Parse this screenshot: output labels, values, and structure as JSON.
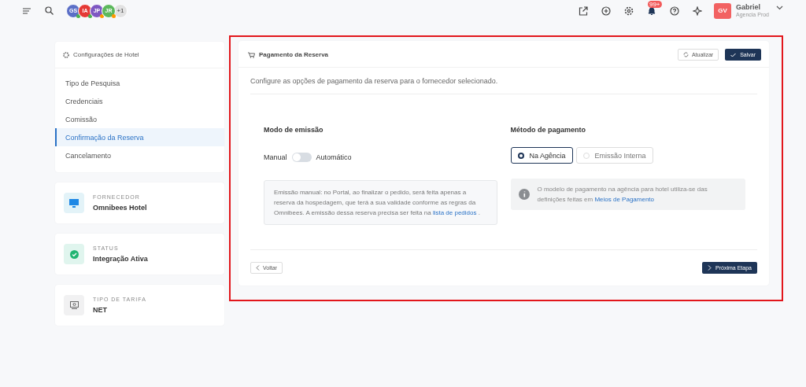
{
  "topbar": {
    "avatars": [
      {
        "initials": "GS",
        "color": "#5b6fc7",
        "status_dot": {
          "color": "#4caf50"
        }
      },
      {
        "initials": "IA",
        "color": "#e53935",
        "status_dot": {
          "color": "#4caf50"
        }
      },
      {
        "initials": "JP",
        "color": "#7e57c2",
        "status_dot": {
          "color": "#ff9800"
        }
      },
      {
        "initials": "JR",
        "color": "#5cb85c",
        "status_dot": {
          "color": "#ff9800"
        }
      }
    ],
    "more_count": "+1",
    "notification_badge": "99+",
    "user": {
      "initials": "GV",
      "name": "Gabriel",
      "agency": "Agencia Prod"
    }
  },
  "sidebar": {
    "title": "Configurações de Hotel",
    "items": [
      {
        "label": "Tipo de Pesquisa",
        "selected": false
      },
      {
        "label": "Credenciais",
        "selected": false
      },
      {
        "label": "Comissão",
        "selected": false
      },
      {
        "label": "Confirmação da Reserva",
        "selected": true
      },
      {
        "label": "Cancelamento",
        "selected": false
      }
    ],
    "info_cards": [
      {
        "kind": "monitor",
        "label": "FORNECEDOR",
        "value": "Omnibees Hotel"
      },
      {
        "kind": "check",
        "label": "STATUS",
        "value": "Integração Ativa"
      },
      {
        "kind": "tariff",
        "label": "TIPO DE TARIFA",
        "value": "NET"
      }
    ]
  },
  "panel": {
    "title": "Pagamento da Reserva",
    "refresh_button": "Atualizar",
    "save_button": "Salvar",
    "description": "Configure as opções de pagamento da reserva para o fornecedor selecionado.",
    "emission": {
      "heading": "Modo de emissão",
      "left_label": "Manual",
      "right_label": "Automático",
      "on": false,
      "note": "Emissão manual: no Portal, ao finalizar o pedido, será feita apenas a reserva da hospedagem, que terá a sua validade conforme as regras da Omnibees. A emissão dessa reserva precisa ser feita na",
      "note_link": "lista de pedidos",
      "note_end": "."
    },
    "payment": {
      "heading": "Método de pagamento",
      "options": [
        {
          "label": "Na Agência",
          "selected": true
        },
        {
          "label": "Emissão Interna",
          "selected": false
        }
      ],
      "info": "O modelo de pagamento na agência para hotel utiliza-se das definições feitas em",
      "info_link": "Meios de Pagamento"
    },
    "back_button": "Voltar",
    "next_button": "Próxima Etapa"
  }
}
